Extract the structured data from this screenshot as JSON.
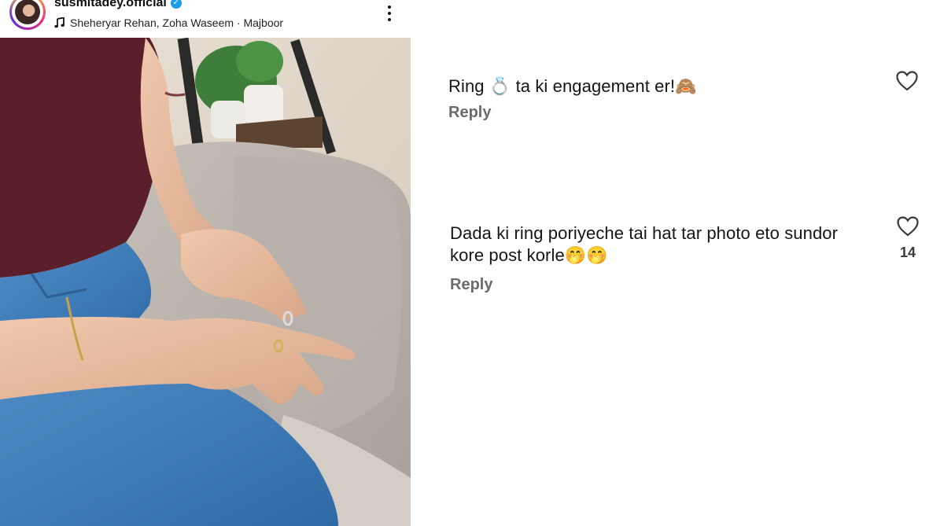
{
  "post": {
    "username": "susmitadey.official",
    "verified_mark": "✓",
    "music": "Sheheryar Rehan, Zoha Waseem · Majboor",
    "icons": {
      "avatar": "profile-avatar",
      "music": "music-note-icon",
      "menu": "more-vertical-icon",
      "verified": "verified-badge-icon"
    }
  },
  "comments": [
    {
      "text": "Ring 💍 ta ki engagement er!🙈",
      "reply_label": "Reply",
      "like_count": ""
    },
    {
      "text": "Dada ki ring poriyeche tai hat tar photo eto sundor kore post korle🤭🤭",
      "reply_label": "Reply",
      "like_count": "14"
    }
  ],
  "colors": {
    "verified": "#1d9bf0",
    "reply": "#6b6b6b",
    "text": "#151515"
  }
}
